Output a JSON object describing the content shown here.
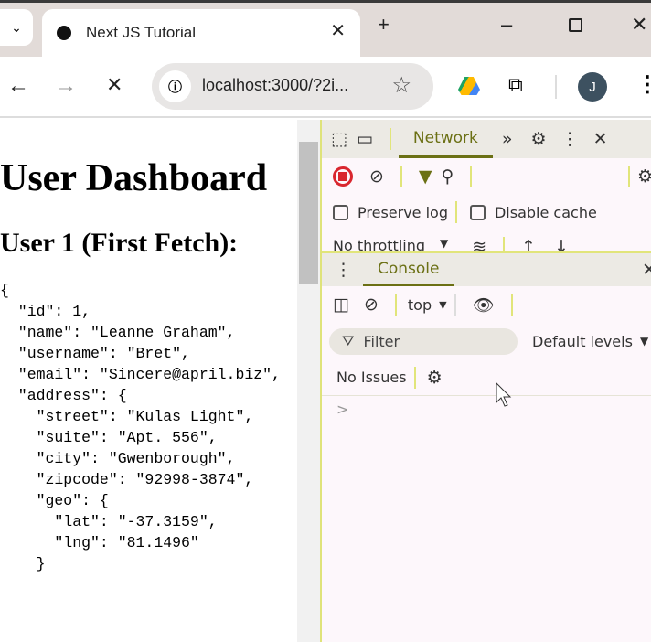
{
  "browser": {
    "tab_title": "Next JS Tutorial",
    "url": "localhost:3000/?2i...",
    "avatar_letter": "J"
  },
  "page": {
    "title": "User Dashboard",
    "subtitle": "User 1 (First Fetch):",
    "json_lines": [
      "{",
      "  \"id\": 1,",
      "  \"name\": \"Leanne Graham\",",
      "  \"username\": \"Bret\",",
      "  \"email\": \"Sincere@april.biz\",",
      "  \"address\": {",
      "    \"street\": \"Kulas Light\",",
      "    \"suite\": \"Apt. 556\",",
      "    \"city\": \"Gwenborough\",",
      "    \"zipcode\": \"92998-3874\",",
      "    \"geo\": {",
      "      \"lat\": \"-37.3159\",",
      "      \"lng\": \"81.1496\"",
      "    }"
    ]
  },
  "devtools": {
    "network_tab": "Network",
    "preserve_log": "Preserve log",
    "disable_cache": "Disable cache",
    "throttling": "No throttling",
    "console_tab": "Console",
    "context": "top",
    "filter_placeholder": "Filter",
    "levels": "Default levels",
    "issues": "No Issues",
    "prompt": ">"
  }
}
